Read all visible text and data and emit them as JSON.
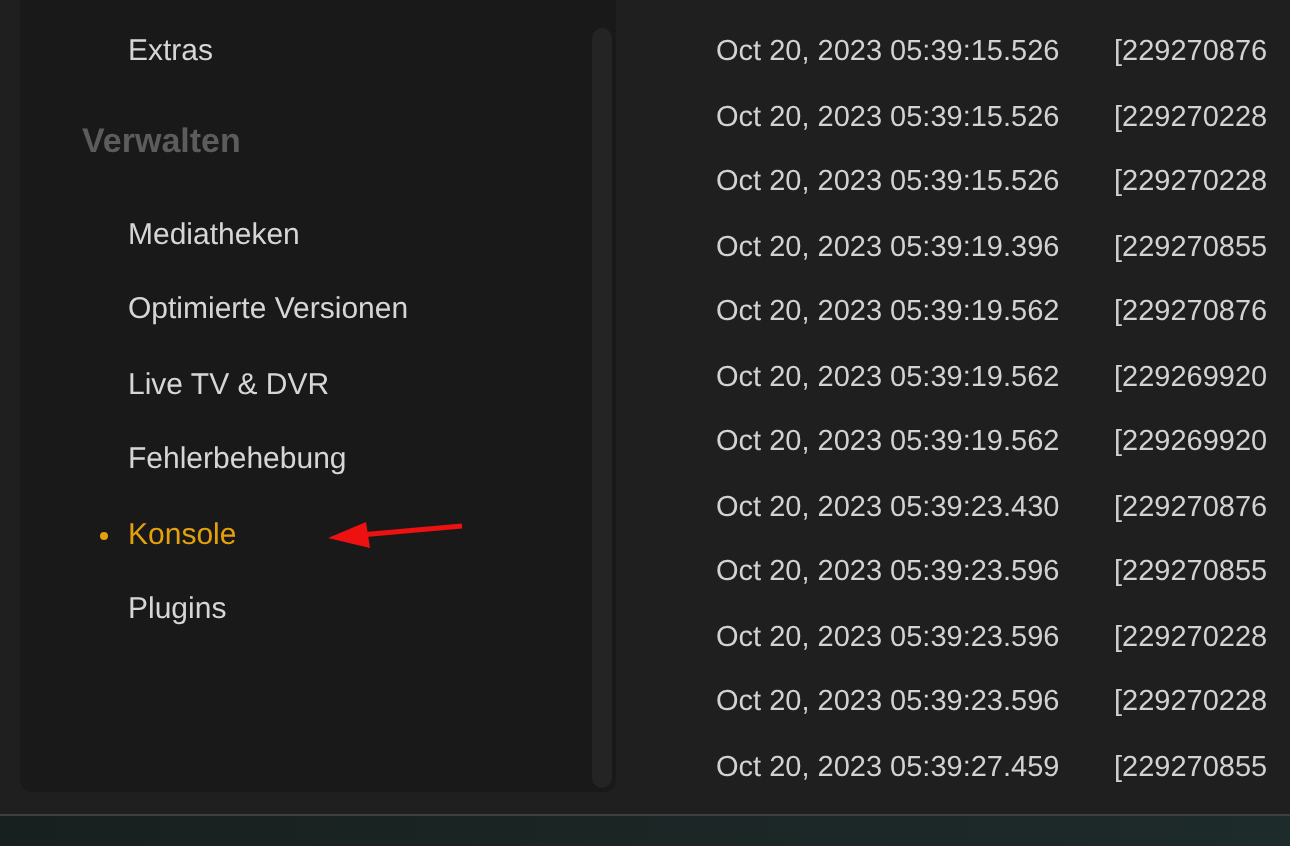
{
  "sidebar": {
    "top_item": {
      "label": "Extras"
    },
    "section": {
      "title": "Verwalten",
      "items": [
        {
          "label": "Mediatheken",
          "selected": false
        },
        {
          "label": "Optimierte Versionen",
          "selected": false
        },
        {
          "label": "Live TV & DVR",
          "selected": false
        },
        {
          "label": "Fehlerbehebung",
          "selected": false
        },
        {
          "label": "Konsole",
          "selected": true
        },
        {
          "label": "Plugins",
          "selected": false
        }
      ]
    }
  },
  "log": {
    "rows": [
      {
        "time": "Oct 20, 2023 05:39:15.526",
        "column_2": "[229270876"
      },
      {
        "time": "Oct 20, 2023 05:39:15.526",
        "column_2": "[229270228"
      },
      {
        "time": "Oct 20, 2023 05:39:15.526",
        "column_2": "[229270228"
      },
      {
        "time": "Oct 20, 2023 05:39:19.396",
        "column_2": "[229270855"
      },
      {
        "time": "Oct 20, 2023 05:39:19.562",
        "column_2": "[229270876"
      },
      {
        "time": "Oct 20, 2023 05:39:19.562",
        "column_2": "[229269920"
      },
      {
        "time": "Oct 20, 2023 05:39:19.562",
        "column_2": "[229269920"
      },
      {
        "time": "Oct 20, 2023 05:39:23.430",
        "column_2": "[229270876"
      },
      {
        "time": "Oct 20, 2023 05:39:23.596",
        "column_2": "[229270855"
      },
      {
        "time": "Oct 20, 2023 05:39:23.596",
        "column_2": "[229270228"
      },
      {
        "time": "Oct 20, 2023 05:39:23.596",
        "column_2": "[229270228"
      },
      {
        "time": "Oct 20, 2023 05:39:27.459",
        "column_2": "[229270855"
      }
    ]
  }
}
